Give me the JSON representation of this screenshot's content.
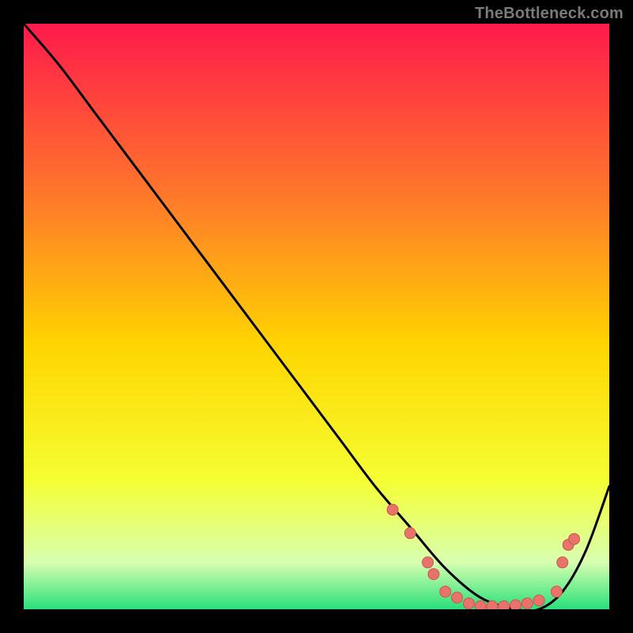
{
  "attribution": "TheBottleneck.com",
  "colors": {
    "frame": "#000000",
    "grad_top": "#ff1a4b",
    "grad_mid1": "#ff7a2a",
    "grad_mid2": "#ffd500",
    "grad_mid3": "#f5ff33",
    "grad_low": "#d8ffb0",
    "grad_bottom": "#29e07a",
    "curve": "#000000",
    "marker_fill": "#e9736b",
    "marker_stroke": "#c55a52"
  },
  "chart_data": {
    "type": "line",
    "title": "",
    "xlabel": "",
    "ylabel": "",
    "xlim": [
      0,
      100
    ],
    "ylim": [
      0,
      100
    ],
    "grid": false,
    "legend": false,
    "series": [
      {
        "name": "bottleneck-curve",
        "x": [
          0,
          6,
          12,
          18,
          24,
          30,
          36,
          42,
          48,
          54,
          60,
          66,
          72,
          78,
          84,
          88,
          92,
          96,
          100
        ],
        "y": [
          100,
          93,
          85,
          77,
          69,
          61,
          53,
          45,
          37,
          29,
          21,
          14,
          7,
          2,
          0,
          0,
          3,
          10,
          21
        ]
      }
    ],
    "markers": [
      {
        "x": 63,
        "y": 17
      },
      {
        "x": 66,
        "y": 13
      },
      {
        "x": 69,
        "y": 8
      },
      {
        "x": 70,
        "y": 6
      },
      {
        "x": 72,
        "y": 3
      },
      {
        "x": 74,
        "y": 2
      },
      {
        "x": 76,
        "y": 1
      },
      {
        "x": 78,
        "y": 0.5
      },
      {
        "x": 80,
        "y": 0.5
      },
      {
        "x": 82,
        "y": 0.5
      },
      {
        "x": 84,
        "y": 0.7
      },
      {
        "x": 86,
        "y": 1
      },
      {
        "x": 88,
        "y": 1.5
      },
      {
        "x": 91,
        "y": 3
      },
      {
        "x": 92,
        "y": 8
      },
      {
        "x": 93,
        "y": 11
      },
      {
        "x": 94,
        "y": 12
      }
    ]
  }
}
